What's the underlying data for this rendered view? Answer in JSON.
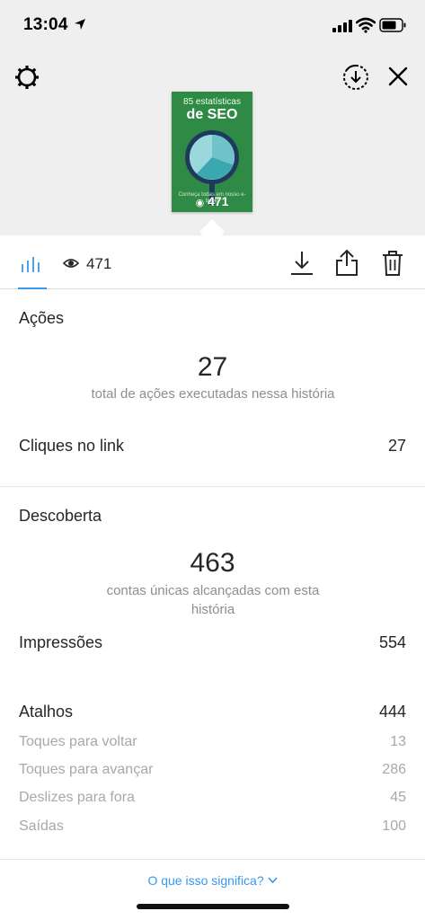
{
  "status_bar": {
    "time": "13:04"
  },
  "story": {
    "thumb_title_line1": "85 estatísticas",
    "thumb_title_line2": "de SEO",
    "thumb_small_text": "Conheça todas em nosso e-book!",
    "views": "471"
  },
  "tabs": {
    "views_count": "471"
  },
  "actions": {
    "title": "Ações",
    "total": "27",
    "total_caption": "total de ações executadas nessa história",
    "rows": [
      {
        "label": "Cliques no link",
        "value": "27"
      }
    ]
  },
  "discovery": {
    "title": "Descoberta",
    "reach": "463",
    "reach_caption": "contas únicas alcançadas com esta história",
    "impressions_label": "Impressões",
    "impressions_value": "554"
  },
  "shortcuts": {
    "title": "Atalhos",
    "total": "444",
    "items": [
      {
        "label": "Toques para voltar",
        "value": "13"
      },
      {
        "label": "Toques para avançar",
        "value": "286"
      },
      {
        "label": "Deslizes para fora",
        "value": "45"
      },
      {
        "label": "Saídas",
        "value": "100"
      }
    ]
  },
  "footer": {
    "link": "O que isso significa?"
  },
  "colors": {
    "accent": "#3897f0",
    "thumb_bg": "#2f8a45",
    "top_bg": "#efefef"
  }
}
